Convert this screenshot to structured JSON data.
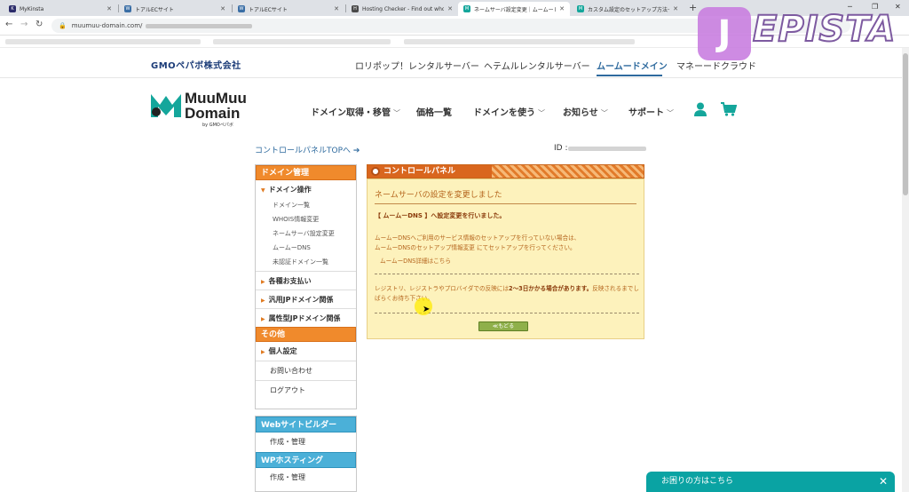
{
  "browser": {
    "tabs": [
      {
        "label": "MyKinsta",
        "icon": "K",
        "color": "#2b2b6a"
      },
      {
        "label": "トアルECサイト",
        "icon": "W",
        "color": "#3a6ea5"
      },
      {
        "label": "トアルECサイト",
        "icon": "W",
        "color": "#3a6ea5"
      },
      {
        "label": "Hosting Checker - Find out who i",
        "icon": "H",
        "color": "#4a4a4a"
      },
      {
        "label": "ネームサーバ設定変更｜ムームードメイ",
        "icon": "M",
        "color": "#14a69b"
      },
      {
        "label": "カスタム設定のセットアップ方法ーム",
        "icon": "M",
        "color": "#14a69b"
      }
    ],
    "new_tab": "+",
    "url": "muumuu-domain.com/"
  },
  "watermark": {
    "first": "J",
    "rest": "EPISTA"
  },
  "gmo_bar": {
    "logo": "GMOペパボ株式会社",
    "links": [
      "ロリポップ！レンタルサーバー",
      "ヘテムルレンタルサーバー",
      "ムームードメイン",
      "マネーードクラウド"
    ]
  },
  "header": {
    "logo_line1": "MuuMuu",
    "logo_line2": "Domain",
    "logo_sub": "by GMOペパボ",
    "nav": [
      {
        "label": "ドメイン取得・移管",
        "chevron": true
      },
      {
        "label": "価格一覧",
        "chevron": false
      },
      {
        "label": "ドメインを使う",
        "chevron": true
      },
      {
        "label": "お知らせ",
        "chevron": true
      },
      {
        "label": "サポート",
        "chevron": true
      }
    ],
    "colors": {
      "accent": "#14a69b"
    }
  },
  "breadcrumb": {
    "cp_link": "コントロールパネルTOPへ ➔",
    "id_label": "ID :"
  },
  "sidebar": {
    "section1": "ドメイン管理",
    "cat_domain_ops": "ドメイン操作",
    "sub_items": [
      "ドメイン一覧",
      "WHOIS情報変更",
      "ネームサーバ設定変更",
      "ムームーDNS",
      "未認証ドメイン一覧"
    ],
    "rows": [
      "各種お支払い",
      "汎用JPドメイン関係",
      "属性型JPドメイン関係"
    ],
    "section2": "その他",
    "row_personal": "個人設定",
    "plain_items": [
      "お問い合わせ",
      "ログアウト"
    ]
  },
  "sidebar2": {
    "head1": "Webサイトビルダー",
    "item1": "作成・管理",
    "head2": "WPホスティング",
    "item2": "作成・管理"
  },
  "panel": {
    "header": "コントロールパネル",
    "title": "ネームサーバの設定を変更しました",
    "success": "【 ムームーDNS 】へ設定変更を行いました。",
    "note_line1": "ムームーDNSへご利用のサービス情報のセットアップを行っていない場合は、",
    "note_line2": "ムームーDNSのセットアップ情報変更 にてセットアップを行ってください。",
    "note_link": "ムームーDNS詳細はこちら",
    "warn_pre": "レジストリ、レジストラやプロバイダでの反映には",
    "warn_bold": "2～3日かかる場合があります。",
    "warn_post": "反映されるまでしばらくお待ち下さい。",
    "back_button": "≪もどる"
  },
  "help_widget": {
    "label": "お困りの方はこちら",
    "close": "✕"
  }
}
